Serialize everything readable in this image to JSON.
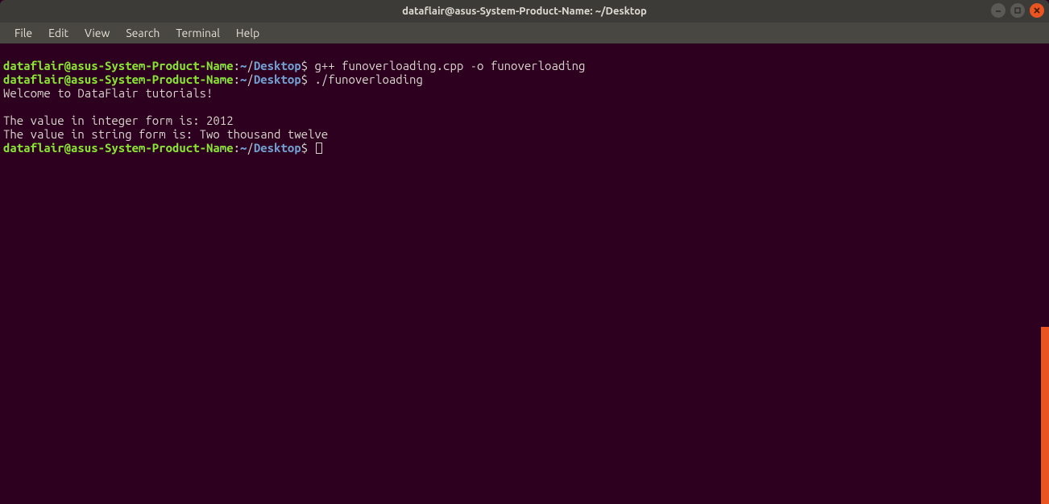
{
  "titlebar": {
    "title": "dataflair@asus-System-Product-Name: ~/Desktop"
  },
  "window_controls": {
    "minimize": "minimize",
    "maximize": "maximize",
    "close": "close"
  },
  "menubar": {
    "items": [
      {
        "label": "File"
      },
      {
        "label": "Edit"
      },
      {
        "label": "View"
      },
      {
        "label": "Search"
      },
      {
        "label": "Terminal"
      },
      {
        "label": "Help"
      }
    ]
  },
  "prompt": {
    "user_host": "dataflair@asus-System-Product-Name",
    "colon": ":",
    "tilde": "~",
    "slash": "/",
    "path": "Desktop",
    "dollar": "$ "
  },
  "lines": {
    "cmd1": "g++ funoverloading.cpp -o funoverloading",
    "cmd2": "./funoverloading",
    "out1": "Welcome to DataFlair tutorials!",
    "blank": "",
    "out2": "The value in integer form is: 2012",
    "out3": "The value in string form is: Two thousand twelve"
  },
  "colors": {
    "bg": "#2c001e",
    "titlebar": "#3c3b37",
    "menubar": "#494741",
    "prompt_green": "#8ae234",
    "prompt_blue": "#729fcf",
    "text": "#d7d3cb",
    "close": "#e95420"
  }
}
